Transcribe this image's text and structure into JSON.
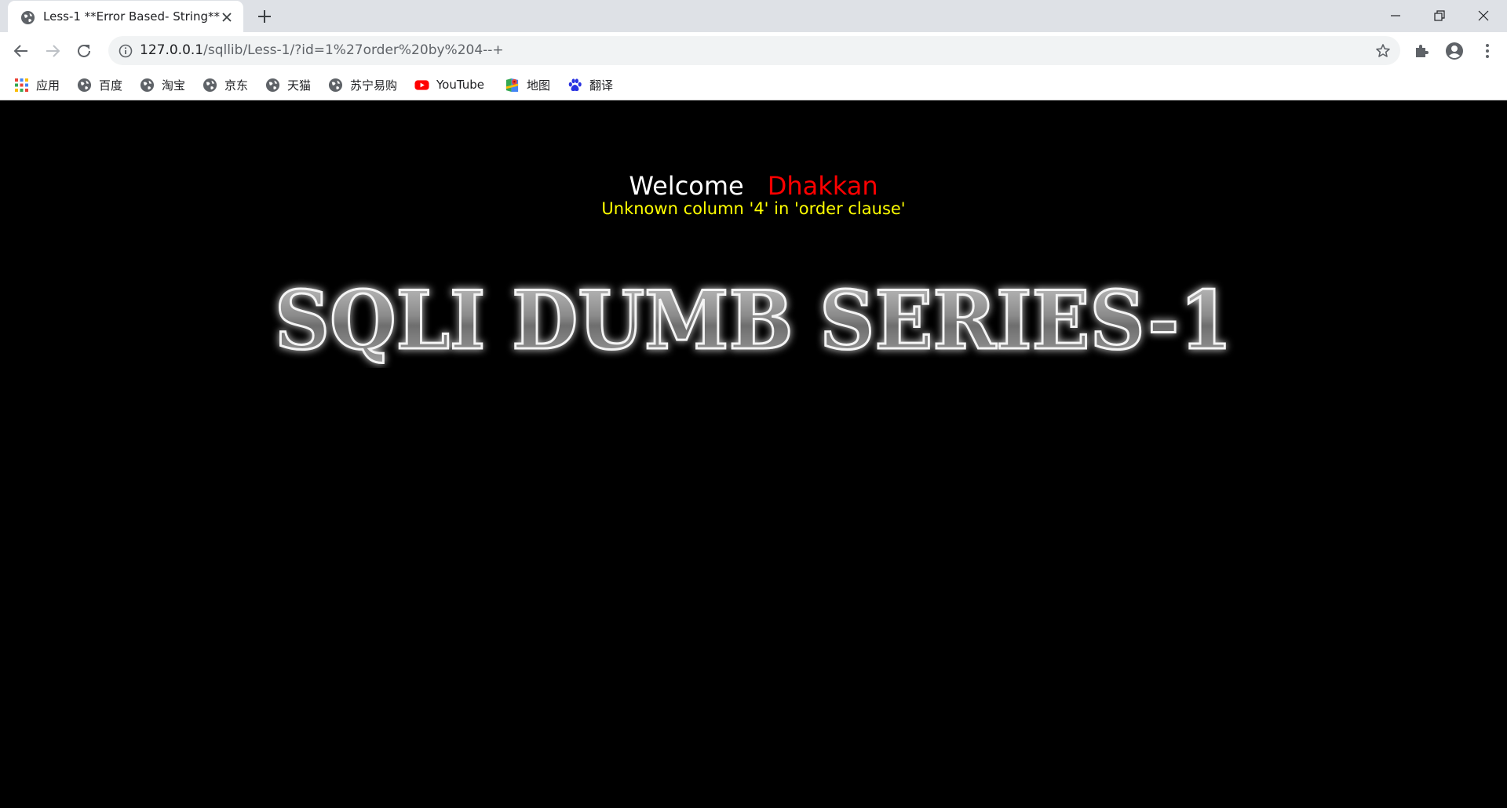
{
  "browser": {
    "tab": {
      "title": "Less-1 **Error Based- String**"
    },
    "address_bar": {
      "host": "127.0.0.1",
      "path": "/sqllib/Less-1/?id=1%27order%20by%204--+"
    },
    "bookmarks": [
      {
        "label": "应用",
        "icon": "apps-grid-icon"
      },
      {
        "label": "百度",
        "icon": "globe-icon"
      },
      {
        "label": "淘宝",
        "icon": "globe-icon"
      },
      {
        "label": "京东",
        "icon": "globe-icon"
      },
      {
        "label": "天猫",
        "icon": "globe-icon"
      },
      {
        "label": "苏宁易购",
        "icon": "globe-icon"
      },
      {
        "label": "YouTube",
        "icon": "youtube-icon"
      },
      {
        "label": "地图",
        "icon": "maps-icon"
      },
      {
        "label": "翻译",
        "icon": "baidu-paw-icon"
      }
    ]
  },
  "page": {
    "welcome": "Welcome",
    "user_name": "Dhakkan",
    "error_message": "Unknown column '4' in 'order clause'",
    "logo_text": "SQLI DUMB SERIES-1"
  },
  "colors": {
    "page_background": "#000000",
    "welcome_text": "#ffffff",
    "name_text": "#ff0000",
    "error_text": "#ffff00"
  }
}
